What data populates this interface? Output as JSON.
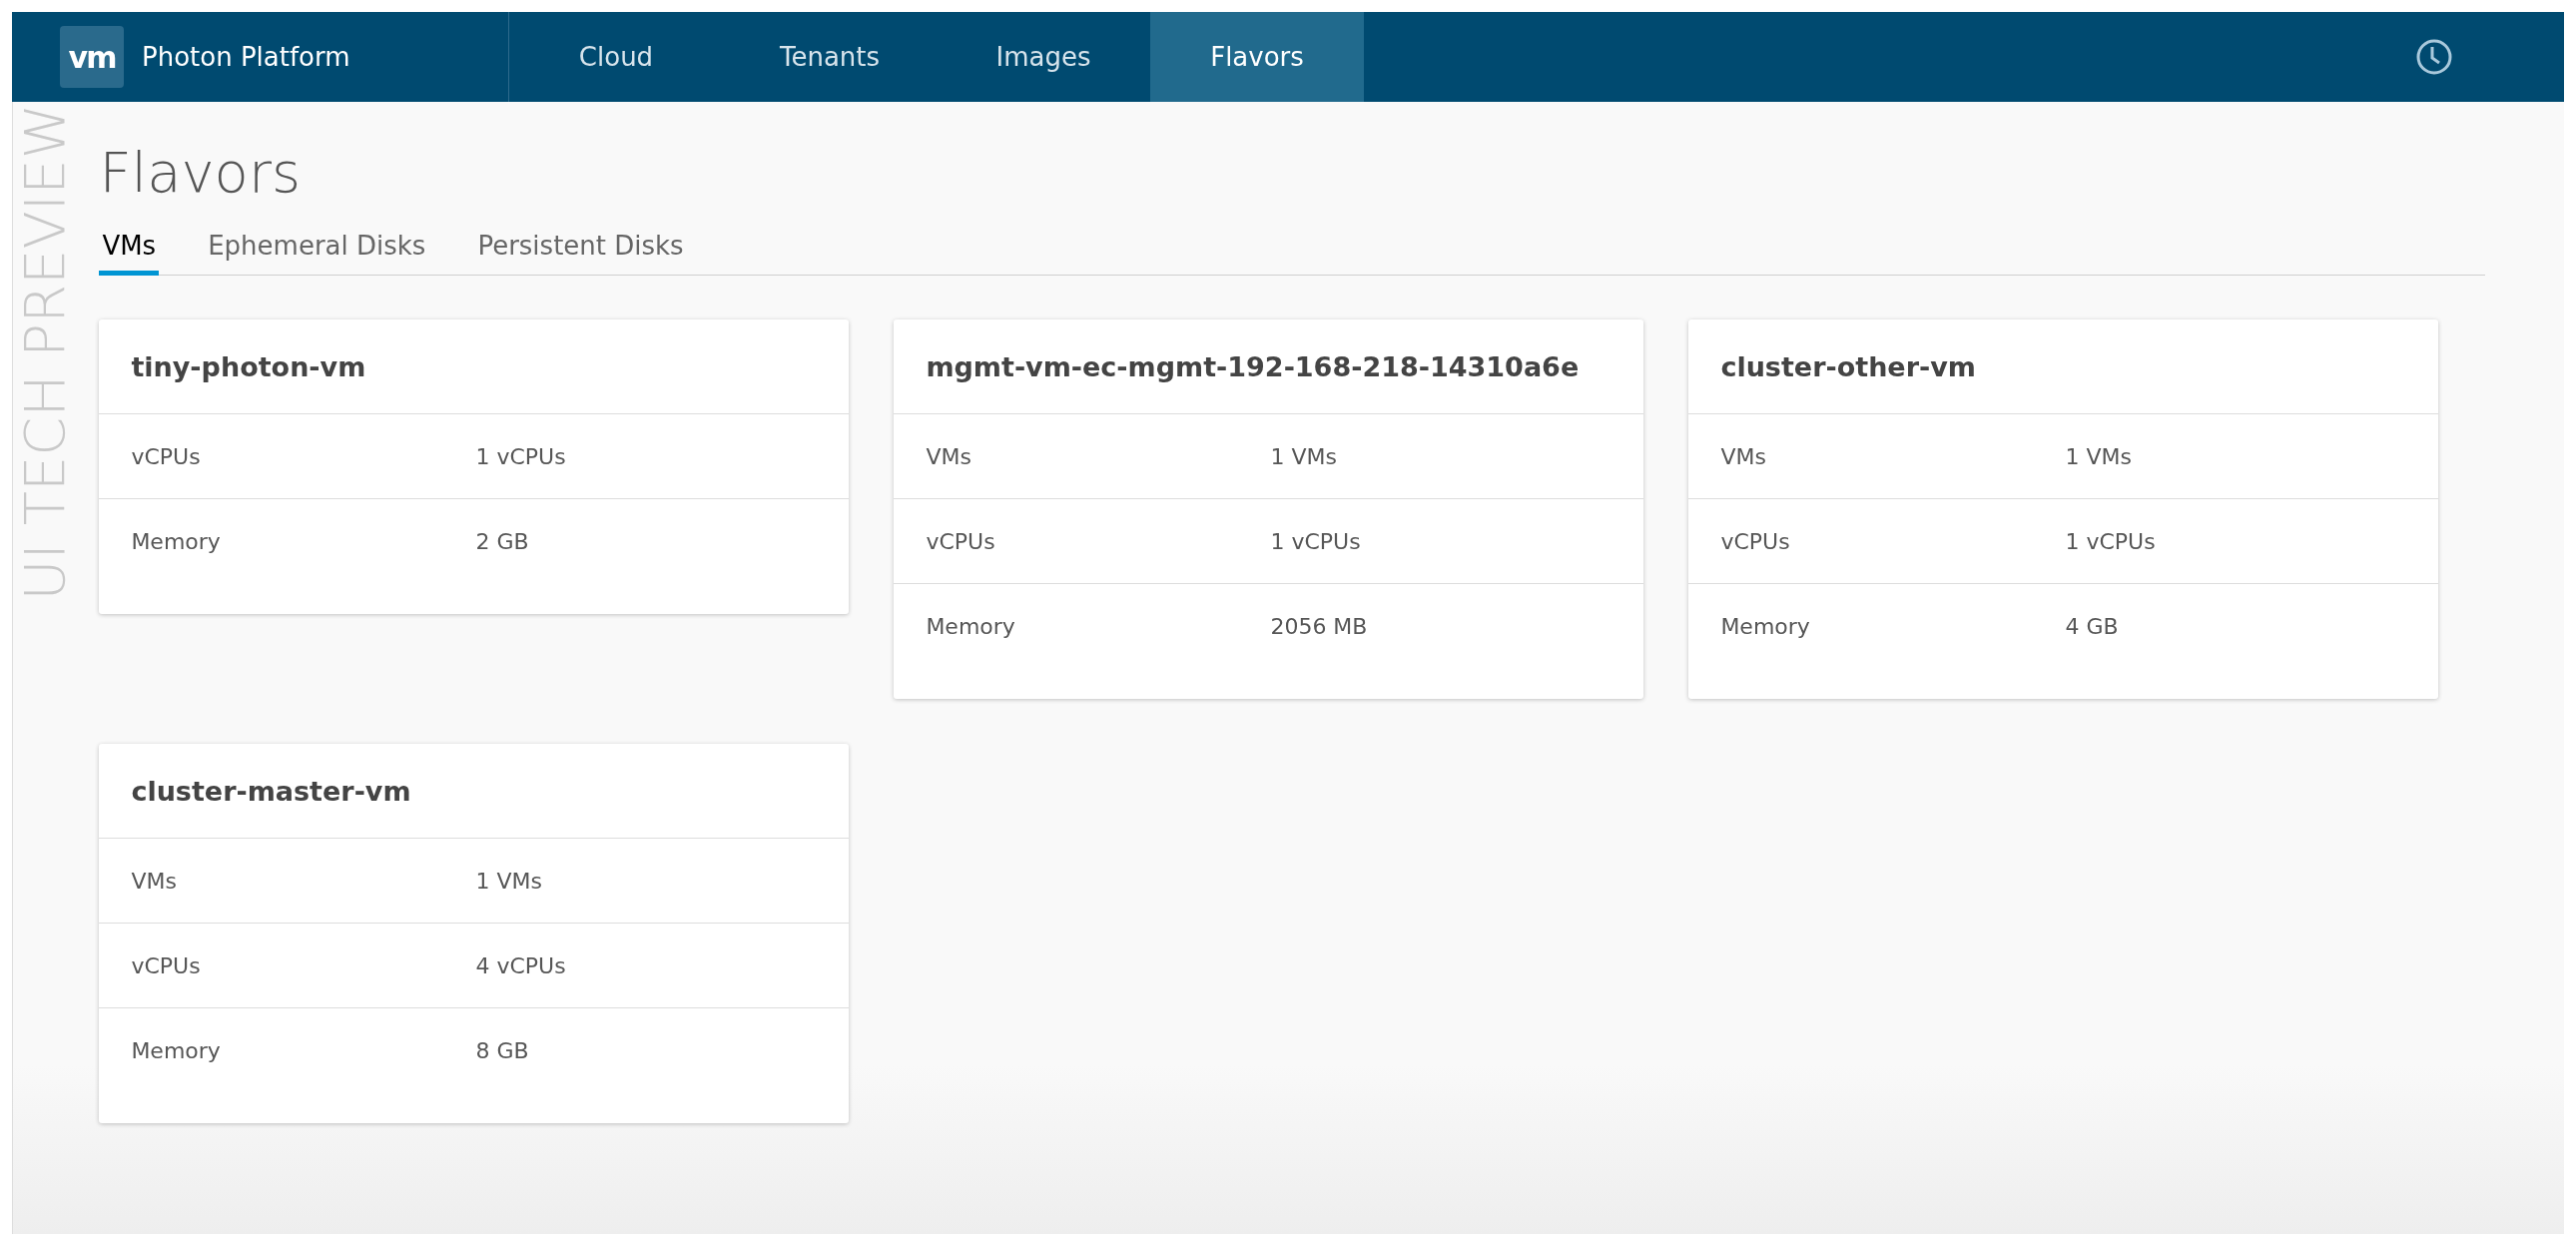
{
  "brand": {
    "logo": "vm",
    "title": "Photon Platform"
  },
  "nav": [
    {
      "label": "Cloud",
      "selected": false
    },
    {
      "label": "Tenants",
      "selected": false
    },
    {
      "label": "Images",
      "selected": false
    },
    {
      "label": "Flavors",
      "selected": true
    }
  ],
  "watermark": "UI TECH PREVIEW",
  "page_title": "Flavors",
  "tabs": [
    {
      "label": "VMs",
      "selected": true
    },
    {
      "label": "Ephemeral Disks",
      "selected": false
    },
    {
      "label": "Persistent Disks",
      "selected": false
    }
  ],
  "cards": [
    {
      "title": "tiny-photon-vm",
      "rows": [
        {
          "label": "vCPUs",
          "value": "1 vCPUs"
        },
        {
          "label": "Memory",
          "value": "2 GB"
        }
      ]
    },
    {
      "title": "mgmt-vm-ec-mgmt-192-168-218-14310a6e",
      "rows": [
        {
          "label": "VMs",
          "value": "1 VMs"
        },
        {
          "label": "vCPUs",
          "value": "1 vCPUs"
        },
        {
          "label": "Memory",
          "value": "2056 MB"
        }
      ]
    },
    {
      "title": "cluster-other-vm",
      "rows": [
        {
          "label": "VMs",
          "value": "1 VMs"
        },
        {
          "label": "vCPUs",
          "value": "1 vCPUs"
        },
        {
          "label": "Memory",
          "value": "4 GB"
        }
      ]
    },
    {
      "title": "cluster-master-vm",
      "rows": [
        {
          "label": "VMs",
          "value": "1 VMs"
        },
        {
          "label": "vCPUs",
          "value": "4 vCPUs"
        },
        {
          "label": "Memory",
          "value": "8 GB"
        }
      ]
    }
  ]
}
